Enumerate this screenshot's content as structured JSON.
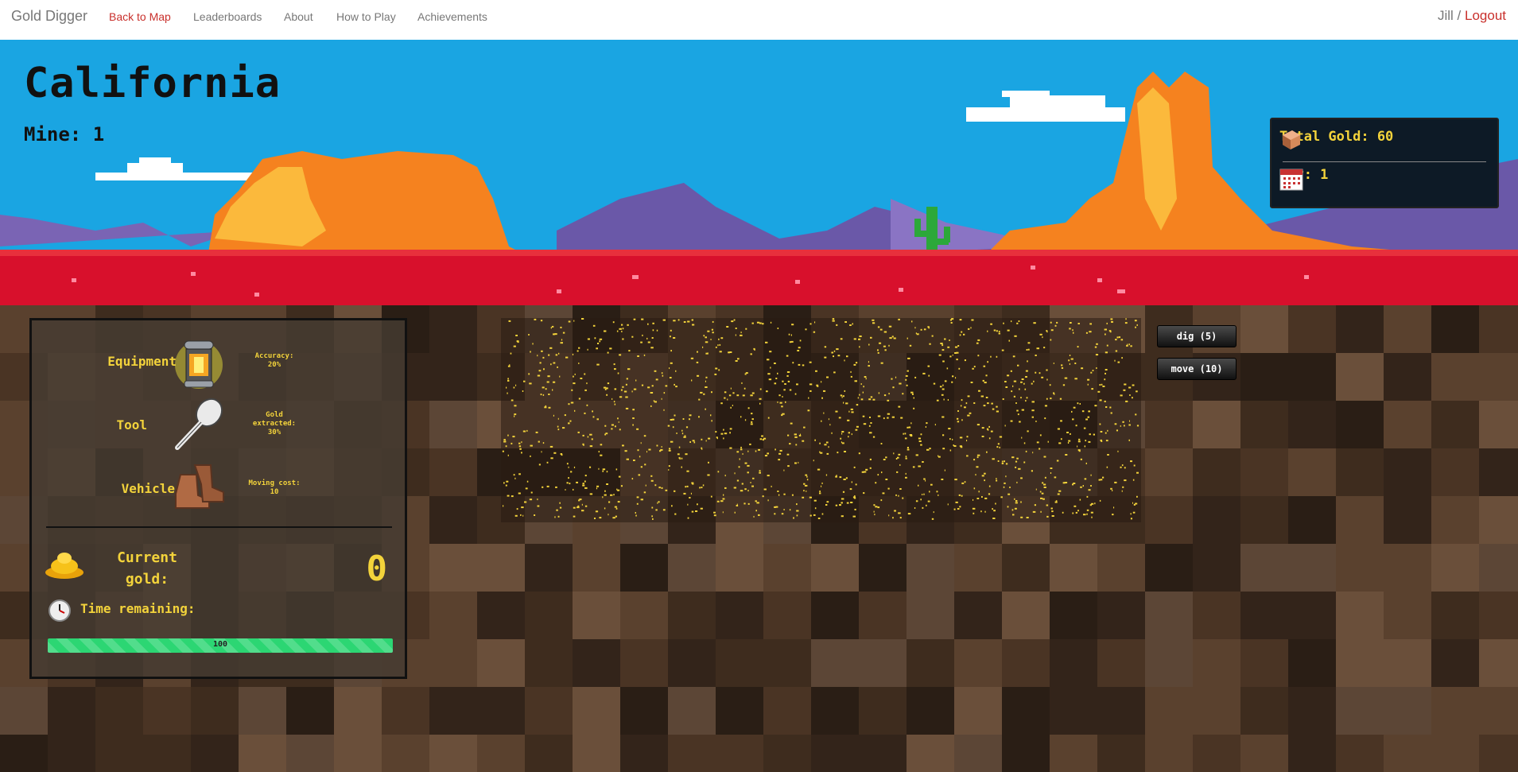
{
  "navbar": {
    "brand": "Gold Digger",
    "links": [
      "Back to Map",
      "Leaderboards",
      "About",
      "How to Play",
      "Achievements"
    ],
    "user": "Jill",
    "separator": "/",
    "logout": "Logout"
  },
  "location": {
    "title": "California",
    "mine_label": "Mine: 1"
  },
  "stats": {
    "total_gold": "Total Gold: 60",
    "day": "Day: 1"
  },
  "panel": {
    "equipment": {
      "label": "Equipment",
      "desc": "Accuracy: 20%",
      "icon": "lantern-icon"
    },
    "tool": {
      "label": "Tool",
      "desc": "Gold extracted: 30%",
      "icon": "spoon-icon"
    },
    "vehicle": {
      "label": "Vehicle",
      "desc": "Moving cost: 10",
      "icon": "boots-icon"
    },
    "current_gold_label": "Current gold:",
    "current_gold_value": "0",
    "time_label": "Time remaining:",
    "time_value": "100",
    "time_fraction": 1.0
  },
  "actions": {
    "dig": "dig (5)",
    "move": "move (10)"
  },
  "colors": {
    "accent_gold": "#f3d33b",
    "progress": "#2cd673",
    "link_red": "#c9302c"
  }
}
